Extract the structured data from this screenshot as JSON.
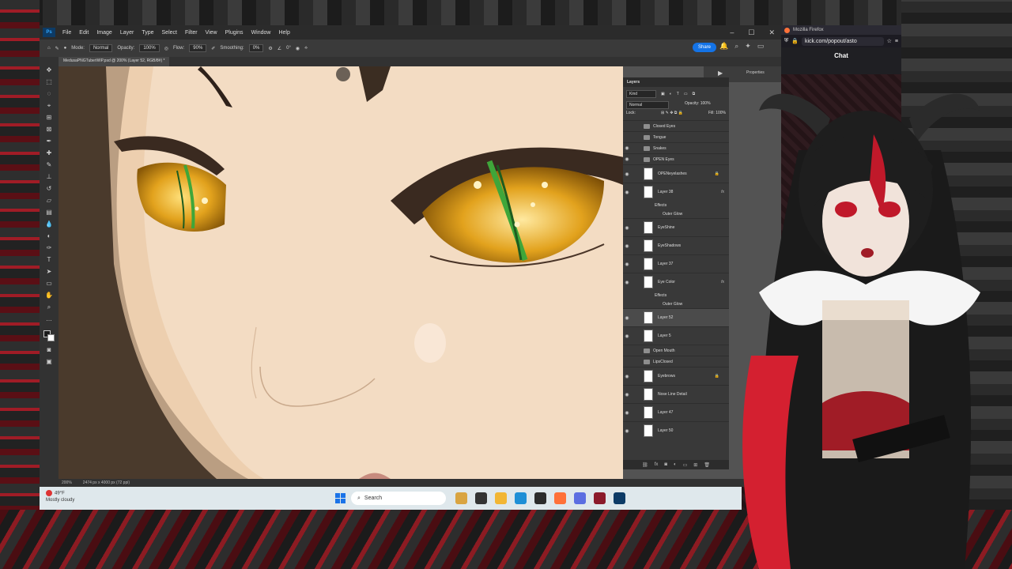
{
  "ps": {
    "menu": [
      "File",
      "Edit",
      "Image",
      "Layer",
      "Type",
      "Select",
      "Filter",
      "View",
      "Plugins",
      "Window",
      "Help"
    ],
    "options": {
      "mode_label": "Mode:",
      "mode_value": "Normal",
      "opacity_label": "Opacity:",
      "opacity_value": "100%",
      "flow_label": "Flow:",
      "flow_value": "90%",
      "smoothing_label": "Smoothing:",
      "smoothing_value": "0%",
      "angle_value": "0°",
      "share_label": "Share"
    },
    "doc_tab": "MedusaPNGTuberWIP.psd @ 200% (Layer 52, RGB/8#) *",
    "status": {
      "zoom": "200%",
      "doc_info": "2474 px x 4000 px (72 ppi)"
    },
    "rightstrip": {
      "props": "Properties"
    }
  },
  "layers": {
    "title": "Layers",
    "filter_kind": "Kind",
    "blend_mode": "Normal",
    "opacity_label": "Opacity:",
    "opacity_value": "100%",
    "lock_label": "Lock:",
    "fill_label": "Fill:",
    "fill_value": "100%",
    "items": [
      {
        "name": "Closed Eyes",
        "kind": "group",
        "visible": false
      },
      {
        "name": "Tongue",
        "kind": "group",
        "visible": false
      },
      {
        "name": "Snakes",
        "kind": "group",
        "visible": true
      },
      {
        "name": "OPEN Eyes",
        "kind": "group",
        "visible": true
      },
      {
        "name": "OPENeyelashes",
        "kind": "layer",
        "visible": true,
        "locked": true
      },
      {
        "name": "Layer 38",
        "kind": "layer",
        "visible": true,
        "fx": true
      },
      {
        "name": "Effects",
        "kind": "effect"
      },
      {
        "name": "Outer Glow",
        "kind": "effect"
      },
      {
        "name": "EyeShine",
        "kind": "layer",
        "visible": true
      },
      {
        "name": "EyeShadows",
        "kind": "layer",
        "visible": true
      },
      {
        "name": "Layer 37",
        "kind": "layer",
        "visible": true
      },
      {
        "name": "Eye Color",
        "kind": "layer",
        "visible": true,
        "fx": true
      },
      {
        "name": "Effects",
        "kind": "effect"
      },
      {
        "name": "Outer Glow",
        "kind": "effect"
      },
      {
        "name": "Layer 52",
        "kind": "layer",
        "visible": true,
        "selected": true
      },
      {
        "name": "Layer 5",
        "kind": "layer",
        "visible": true
      },
      {
        "name": "Open Mouth",
        "kind": "group",
        "visible": false
      },
      {
        "name": "LipsClosed",
        "kind": "group",
        "visible": false
      },
      {
        "name": "Eyebrows",
        "kind": "layer",
        "visible": true,
        "locked": true
      },
      {
        "name": "Nose Line Detail",
        "kind": "layer",
        "visible": true
      },
      {
        "name": "Layer 47",
        "kind": "layer",
        "visible": true
      },
      {
        "name": "Layer 50",
        "kind": "layer",
        "visible": true
      }
    ]
  },
  "firefox": {
    "title": "Mozilla Firefox",
    "url": "kick.com/popout/asto",
    "chat_title": "Chat"
  },
  "taskbar": {
    "weather_temp": "49°F",
    "weather_desc": "Mostly cloudy",
    "search_placeholder": "Search"
  },
  "colors": {
    "ps_bg": "#535353",
    "skin": "#f3dcc3",
    "eye_gold": "#e2a21d",
    "eye_green": "#3fa63a",
    "accent_blue": "#1473e6",
    "frame_red": "#a01c26"
  }
}
